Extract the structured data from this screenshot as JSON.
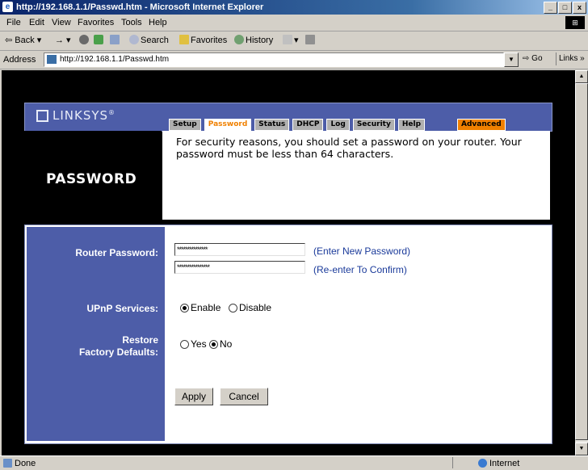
{
  "window": {
    "title": "http://192.168.1.1/Passwd.htm - Microsoft Internet Explorer",
    "btn_min": "_",
    "btn_max": "□",
    "btn_close": "x"
  },
  "menu": [
    "File",
    "Edit",
    "View",
    "Favorites",
    "Tools",
    "Help"
  ],
  "toolbar": {
    "back": "Back",
    "forward": "→",
    "search": "Search",
    "favorites": "Favorites",
    "history": "History"
  },
  "address": {
    "label": "Address",
    "url": "http://192.168.1.1/Passwd.htm",
    "go": "Go",
    "links": "Links »"
  },
  "page": {
    "logo": "LINKSYS",
    "logo_mark": "®",
    "tabs": [
      "Setup",
      "Password",
      "Status",
      "DHCP",
      "Log",
      "Security",
      "Help"
    ],
    "active_tab": "Password",
    "advanced_tab": "Advanced",
    "section_title": "PASSWORD",
    "intro": "For security reasons, you should set a password on your router. Your password must be less than 64 characters.",
    "router_password_label": "Router Password:",
    "password_mask": "***************",
    "confirm_mask": "****************",
    "enter_hint": "(Enter New Password)",
    "reenter_hint": "(Re-enter To Confirm)",
    "upnp_label": "UPnP Services:",
    "upnp_enable": "Enable",
    "upnp_disable": "Disable",
    "upnp_selected": "Enable",
    "restore_label_1": "Restore",
    "restore_label_2": "Factory Defaults:",
    "restore_yes": "Yes",
    "restore_no": "No",
    "restore_selected": "No",
    "apply": "Apply",
    "cancel": "Cancel"
  },
  "status": {
    "left": "Done",
    "right": "Internet"
  }
}
